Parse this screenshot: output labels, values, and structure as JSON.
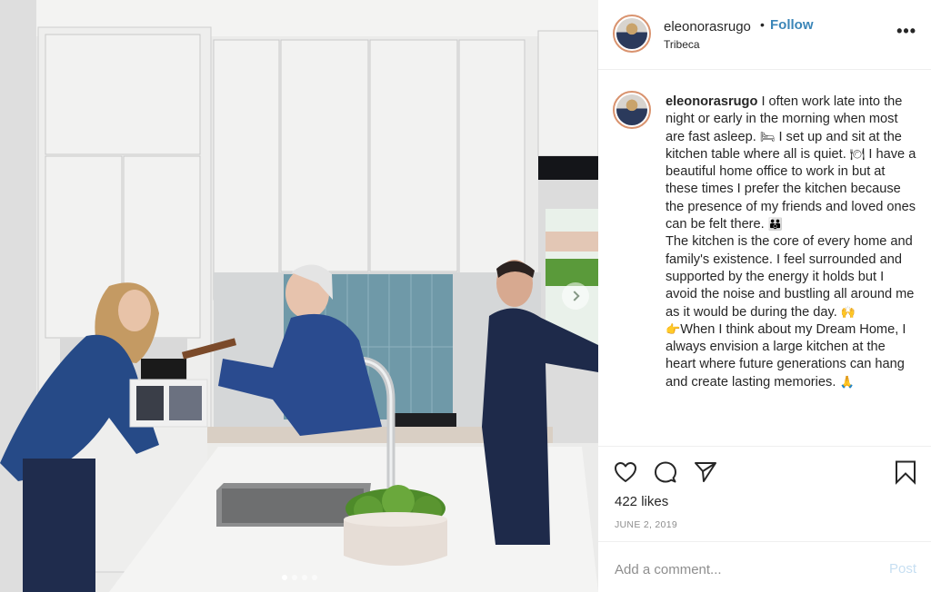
{
  "post": {
    "username": "eleonorasrugo",
    "follow_label": "Follow",
    "separator": "•",
    "location": "Tribeca",
    "more_label": "•••",
    "caption": {
      "username": "eleonorasrugo",
      "segments": [
        "I often work late into the night or early in the morning when most are fast asleep.",
        "I set up and sit at the kitchen table where all is quiet.",
        "I have a beautiful home office to work in but at these times I prefer the kitchen because the presence of my friends and loved ones can be felt there.",
        "The kitchen is the core of every home and family's existence. I feel surrounded and supported by the energy it holds but I avoid the noise and bustling all around me as it would be during the day.",
        "When I think about my Dream Home, I always envision a large kitchen at the heart where future generations can hang and create lasting memories."
      ],
      "emojis": {
        "bed": "🛏",
        "plate": "🍽",
        "family": "👪",
        "hands": "🙌",
        "point": "👉",
        "pray": "🙏"
      }
    },
    "likes": "422 likes",
    "date": "JUNE 2, 2019",
    "comment_placeholder": "Add a comment...",
    "post_label": "Post"
  },
  "carousel": {
    "total_slides": 4,
    "active_slide": 1
  },
  "icons": {
    "like": "heart-icon",
    "comment": "comment-icon",
    "share": "share-icon",
    "save": "bookmark-icon",
    "next": "chevron-right-icon"
  },
  "colors": {
    "follow": "#3b86b8",
    "avatar_ring": "#d9936f",
    "post_disabled": "#c7dff2",
    "muted_text": "#8e8e8e",
    "divider": "#efefef"
  }
}
